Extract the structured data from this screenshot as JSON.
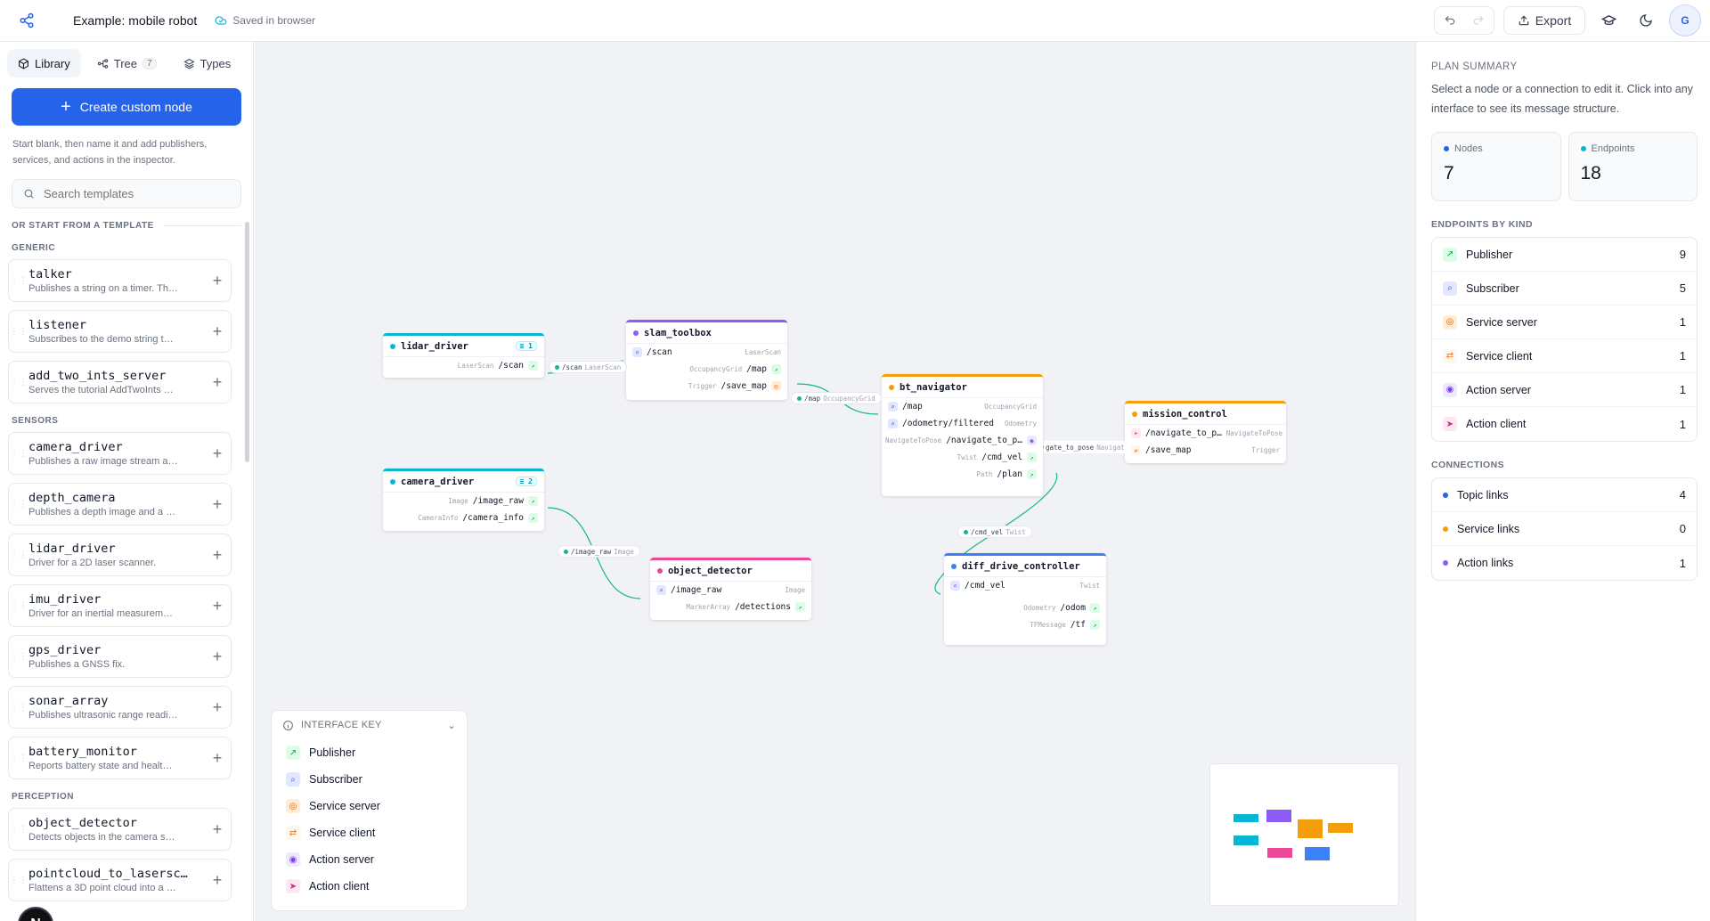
{
  "header": {
    "title": "Example: mobile robot",
    "saved": "Saved in browser",
    "export_label": "Export",
    "avatar": "G"
  },
  "left": {
    "tabs": [
      {
        "label": "Library"
      },
      {
        "label": "Tree",
        "count": "7"
      },
      {
        "label": "Types"
      }
    ],
    "create_label": "Create custom node",
    "hint": "Start blank, then name it and add publishers, services, and actions in the inspector.",
    "search_placeholder": "Search templates",
    "template_heading": "OR START FROM A TEMPLATE",
    "categories": [
      {
        "name": "GENERIC",
        "items": [
          {
            "name": "talker",
            "desc": "Publishes a string on a timer. Th…"
          },
          {
            "name": "listener",
            "desc": "Subscribes to the demo string t…"
          },
          {
            "name": "add_two_ints_server",
            "desc": "Serves the tutorial AddTwoInts …"
          }
        ]
      },
      {
        "name": "SENSORS",
        "items": [
          {
            "name": "camera_driver",
            "desc": "Publishes a raw image stream a…"
          },
          {
            "name": "depth_camera",
            "desc": "Publishes a depth image and a …"
          },
          {
            "name": "lidar_driver",
            "desc": "Driver for a 2D laser scanner."
          },
          {
            "name": "imu_driver",
            "desc": "Driver for an inertial measurem…"
          },
          {
            "name": "gps_driver",
            "desc": "Publishes a GNSS fix."
          },
          {
            "name": "sonar_array",
            "desc": "Publishes ultrasonic range readi…"
          },
          {
            "name": "battery_monitor",
            "desc": "Reports battery state and healt…"
          }
        ]
      },
      {
        "name": "PERCEPTION",
        "items": [
          {
            "name": "object_detector",
            "desc": "Detects objects in the camera s…"
          },
          {
            "name": "pointcloud_to_lasersc…",
            "desc": "Flattens a 3D point cloud into a …"
          }
        ]
      }
    ],
    "badge": "N"
  },
  "canvas": {
    "nodes": {
      "lidar_driver": {
        "name": "lidar_driver",
        "pill": "≡ 1",
        "rows": [
          {
            "type": "LaserScan",
            "topic": "/scan"
          }
        ]
      },
      "slam_toolbox": {
        "name": "slam_toolbox",
        "rows": [
          {
            "topic": "/scan",
            "type": "LaserScan"
          },
          {
            "type": "OccupancyGrid",
            "topic": "/map"
          },
          {
            "type": "Trigger",
            "topic": "/save_map"
          }
        ]
      },
      "bt_navigator": {
        "name": "bt_navigator",
        "rows": [
          {
            "topic": "/map",
            "type": "OccupancyGrid"
          },
          {
            "topic": "/odometry/filtered",
            "type": "Odometry"
          },
          {
            "type": "NavigateToPose",
            "topic": "/navigate_to_p…"
          },
          {
            "type": "Twist",
            "topic": "/cmd_vel"
          },
          {
            "type": "Path",
            "topic": "/plan"
          }
        ]
      },
      "mission_control": {
        "name": "mission_control",
        "rows": [
          {
            "topic": "/navigate_to_p…",
            "type": "NavigateToPose"
          },
          {
            "topic": "/save_map",
            "type": "Trigger"
          }
        ]
      },
      "camera_driver": {
        "name": "camera_driver",
        "pill": "≡ 2",
        "rows": [
          {
            "type": "Image",
            "topic": "/image_raw"
          },
          {
            "type": "CameraInfo",
            "topic": "/camera_info"
          }
        ]
      },
      "object_detector": {
        "name": "object_detector",
        "rows": [
          {
            "topic": "/image_raw",
            "type": "Image"
          },
          {
            "type": "MarkerArray",
            "topic": "/detections"
          }
        ]
      },
      "diff_drive_controller": {
        "name": "diff_drive_controller",
        "rows": [
          {
            "topic": "/cmd_vel",
            "type": "Twist"
          },
          {
            "type": "Odometry",
            "topic": "/odom"
          },
          {
            "type": "TFMessage",
            "topic": "/tf"
          }
        ]
      }
    },
    "edges": [
      {
        "topic": "/scan",
        "type": "LaserScan"
      },
      {
        "topic": "/map",
        "type": "OccupancyGrid"
      },
      {
        "topic": "/image_raw",
        "type": "Image"
      },
      {
        "topic": "/cmd_vel",
        "type": "Twist"
      },
      {
        "topic": "gate_to_pose",
        "type": "Navigat"
      }
    ],
    "key": {
      "title": "INTERFACE KEY",
      "items": [
        "Publisher",
        "Subscriber",
        "Service server",
        "Service client",
        "Action server",
        "Action client"
      ]
    }
  },
  "right": {
    "heading": "PLAN SUMMARY",
    "desc": "Select a node or a connection to edit it. Click into any interface to see its message structure.",
    "stats": [
      {
        "label": "Nodes",
        "value": "7"
      },
      {
        "label": "Endpoints",
        "value": "18"
      }
    ],
    "kinds_heading": "ENDPOINTS BY KIND",
    "kinds": [
      {
        "label": "Publisher",
        "value": "9"
      },
      {
        "label": "Subscriber",
        "value": "5"
      },
      {
        "label": "Service server",
        "value": "1"
      },
      {
        "label": "Service client",
        "value": "1"
      },
      {
        "label": "Action server",
        "value": "1"
      },
      {
        "label": "Action client",
        "value": "1"
      }
    ],
    "conn_heading": "CONNECTIONS",
    "connections": [
      {
        "label": "Topic links",
        "value": "4"
      },
      {
        "label": "Service links",
        "value": "0"
      },
      {
        "label": "Action links",
        "value": "1"
      }
    ]
  },
  "colors": {
    "accent": "#2563eb",
    "topic": "#10b981",
    "cyan": "#06b6d4",
    "purple": "#8b5cf6",
    "orange": "#f59e0b",
    "pink": "#ec4899",
    "blue": "#3b82f6"
  }
}
